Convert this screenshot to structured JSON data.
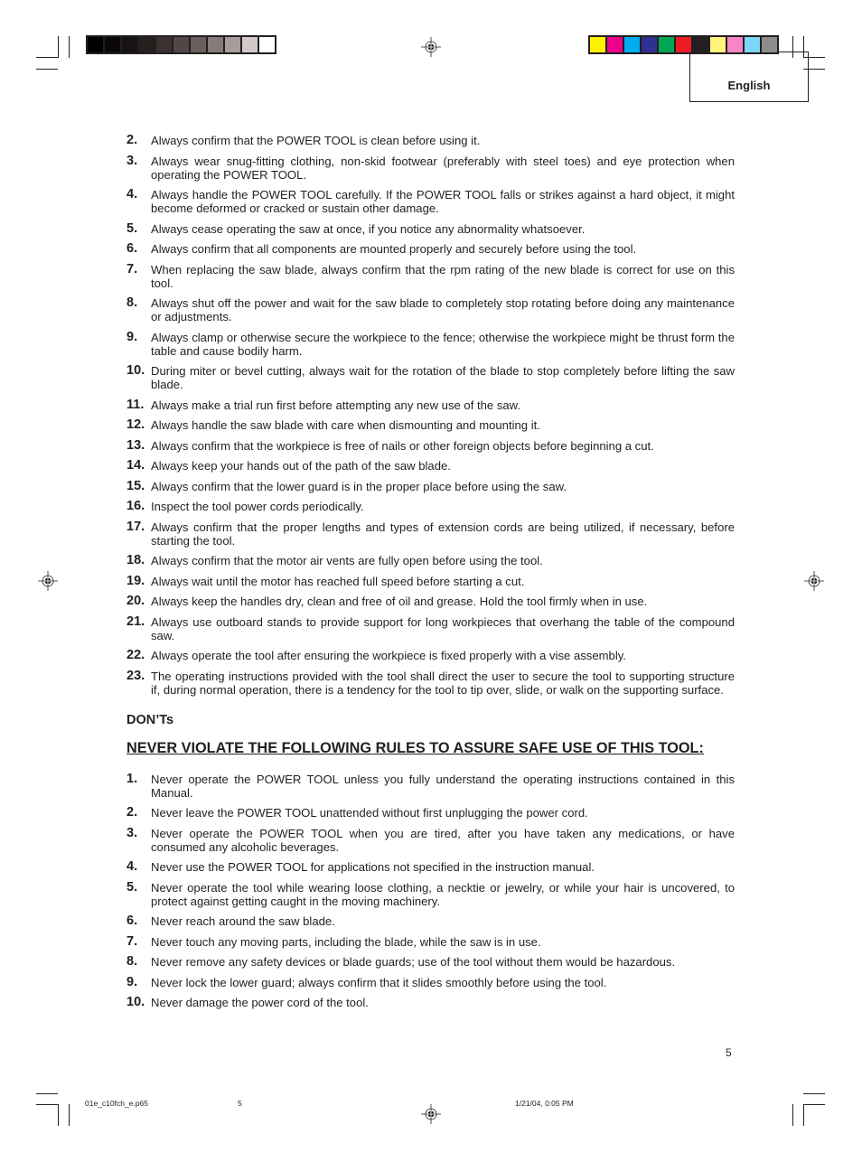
{
  "header": {
    "language_tab": "English",
    "gray_swatches": [
      "#000000",
      "#0b0908",
      "#171312",
      "#241f1c",
      "#3b3130",
      "#524747",
      "#6b5f5d",
      "#877b79",
      "#a69c99",
      "#d3c9c8",
      "#ffffff"
    ],
    "color_swatches": [
      "#fff200",
      "#ec008c",
      "#00aeef",
      "#2e3192",
      "#00a651",
      "#ed1c24",
      "#231f20",
      "#fff57d",
      "#f784c4",
      "#7dd5f7",
      "#8f8c8c"
    ]
  },
  "dos_items": [
    {
      "num": "2.",
      "text": "Always confirm that the POWER TOOL is clean before using it."
    },
    {
      "num": "3.",
      "text": "Always wear snug-fitting clothing, non-skid footwear (preferably with steel toes) and eye protection when operating the POWER TOOL."
    },
    {
      "num": "4.",
      "text": "Always handle the POWER TOOL carefully. If the POWER TOOL falls or strikes against a hard object, it might become deformed or cracked or sustain other damage."
    },
    {
      "num": "5.",
      "text": "Always cease operating the saw at once, if you notice any abnormality whatsoever."
    },
    {
      "num": "6.",
      "text": "Always confirm that all components are mounted properly and securely before using the tool."
    },
    {
      "num": "7.",
      "text": "When replacing the saw blade, always confirm that the rpm rating of the new blade is correct for use on this tool."
    },
    {
      "num": "8.",
      "text": "Always shut off the power and wait for the saw blade to completely stop rotating before doing any maintenance or adjustments."
    },
    {
      "num": "9.",
      "text": "Always clamp or otherwise secure the workpiece to the fence; otherwise the workpiece might be thrust form the table and cause bodily harm."
    },
    {
      "num": "10.",
      "text": "During miter or bevel cutting, always wait for the rotation of the blade to stop completely before lifting the saw blade."
    },
    {
      "num": "11.",
      "text": "Always make a trial run first before attempting any new use of the saw."
    },
    {
      "num": "12.",
      "text": "Always handle the saw blade with care when dismounting and mounting it."
    },
    {
      "num": "13.",
      "text": "Always confirm that the workpiece is free of nails or other foreign objects before beginning a cut."
    },
    {
      "num": "14.",
      "text": "Always keep your hands out of the path of the saw blade."
    },
    {
      "num": "15.",
      "text": "Always confirm that the lower guard is in the proper place before using the saw."
    },
    {
      "num": "16.",
      "text": "Inspect the tool power cords periodically."
    },
    {
      "num": "17.",
      "text": "Always confirm that the proper lengths and types of extension cords are being utilized, if necessary, before starting the tool."
    },
    {
      "num": "18.",
      "text": "Always confirm that the motor air vents are fully open before using the tool."
    },
    {
      "num": "19.",
      "text": "Always wait until the motor has reached full speed before starting a cut."
    },
    {
      "num": "20.",
      "text": "Always keep the handles dry, clean and free of oil and grease. Hold the tool firmly when in use."
    },
    {
      "num": "21.",
      "text": "Always use outboard stands to provide support for long workpieces that overhang the table of the compound saw."
    },
    {
      "num": "22.",
      "text": "Always operate the tool after ensuring the workpiece is fixed properly with a vise assembly."
    },
    {
      "num": "23.",
      "text": "The operating instructions provided with the tool shall direct the user to secure the tool to supporting structure if, during normal operation, there is a tendency for the tool to tip over, slide, or walk on the supporting surface."
    }
  ],
  "donts": {
    "title": "DON’Ts",
    "heading": "NEVER VIOLATE THE FOLLOWING RULES TO ASSURE SAFE USE OF THIS TOOL:",
    "items": [
      {
        "num": "1.",
        "text": "Never operate the POWER TOOL unless you fully understand the operating instructions contained in this Manual."
      },
      {
        "num": "2.",
        "text": "Never leave the POWER TOOL unattended without first unplugging the power cord."
      },
      {
        "num": "3.",
        "text": "Never operate the POWER TOOL when you are tired, after you have taken any medications, or have consumed any alcoholic beverages."
      },
      {
        "num": "4.",
        "text": "Never use the POWER TOOL for applications not specified in the instruction manual."
      },
      {
        "num": "5.",
        "text": "Never operate the tool while wearing loose clothing, a necktie or jewelry, or while your hair is uncovered, to protect against getting caught in the moving machinery."
      },
      {
        "num": "6.",
        "text": "Never reach around the saw blade."
      },
      {
        "num": "7.",
        "text": "Never touch any moving parts, including the blade, while the saw is in use."
      },
      {
        "num": "8.",
        "text": "Never remove any safety devices or blade guards; use of the tool without them would be hazardous."
      },
      {
        "num": "9.",
        "text": "Never lock the lower guard; always confirm that it slides smoothly before using the tool."
      },
      {
        "num": "10.",
        "text": "Never damage the power cord of the tool."
      }
    ]
  },
  "footer": {
    "page_number": "5",
    "slug_filename": "01e_c10fch_e.p65",
    "slug_page": "5",
    "slug_datetime": "1/21/04, 0:05 PM"
  }
}
